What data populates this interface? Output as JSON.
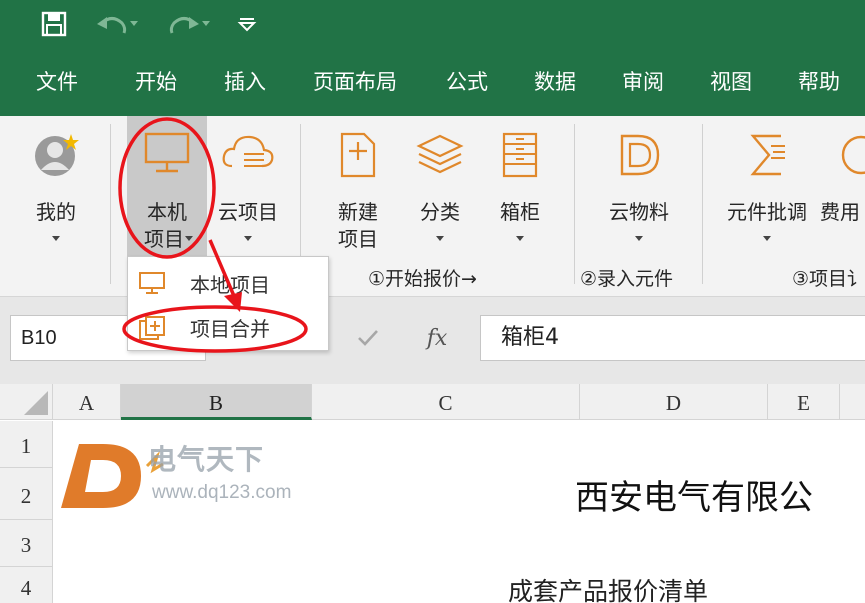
{
  "quick_access": {
    "save_icon": "save-icon",
    "undo_icon": "undo-icon",
    "redo_icon": "redo-icon",
    "customize_icon": "customize-qat-icon"
  },
  "tabs": [
    {
      "label": "文件"
    },
    {
      "label": "开始"
    },
    {
      "label": "插入"
    },
    {
      "label": "页面布局"
    },
    {
      "label": "公式"
    },
    {
      "label": "数据"
    },
    {
      "label": "审阅"
    },
    {
      "label": "视图"
    },
    {
      "label": "帮助"
    }
  ],
  "ribbon": {
    "mine": {
      "label": "我的",
      "icon": "user-avatar-icon"
    },
    "local_project": {
      "line1": "本机",
      "line2": "项目",
      "icon": "monitor-icon"
    },
    "cloud_project": {
      "label": "云项目",
      "icon": "cloud-list-icon"
    },
    "new_project": {
      "line1": "新建",
      "line2": "项目",
      "icon": "new-document-icon"
    },
    "category": {
      "label": "分类",
      "icon": "layers-icon"
    },
    "cabinet": {
      "label": "箱柜",
      "icon": "cabinet-icon"
    },
    "cloud_material": {
      "label": "云物料",
      "icon": "cloud-material-icon"
    },
    "component_batch": {
      "label": "元件批调",
      "icon": "sigma-list-icon"
    },
    "cost": {
      "label": "费用",
      "icon": "cost-icon"
    },
    "groups": {
      "start_quote": "①开始报价→",
      "enter_components": "②录入元件",
      "project_partial": "③项目讠"
    }
  },
  "dropdown": {
    "items": [
      {
        "label": "本地项目",
        "icon": "monitor-icon"
      },
      {
        "label": "项目合并",
        "icon": "merge-icon"
      }
    ]
  },
  "formula_bar": {
    "name_box": "B10",
    "fx_label": "fx",
    "content": "箱柜4"
  },
  "columns": [
    "A",
    "B",
    "C",
    "D",
    "E"
  ],
  "rows": [
    "1",
    "2",
    "3",
    "4"
  ],
  "cells": {
    "title": "西安电气有限公",
    "subtitle": "成套产品报价清单"
  },
  "watermark": {
    "name": "电气天下",
    "url": "www.dq123.com"
  },
  "colors": {
    "excel_green": "#217346",
    "annotation_red": "#e8141b",
    "icon_orange": "#e0882b"
  }
}
